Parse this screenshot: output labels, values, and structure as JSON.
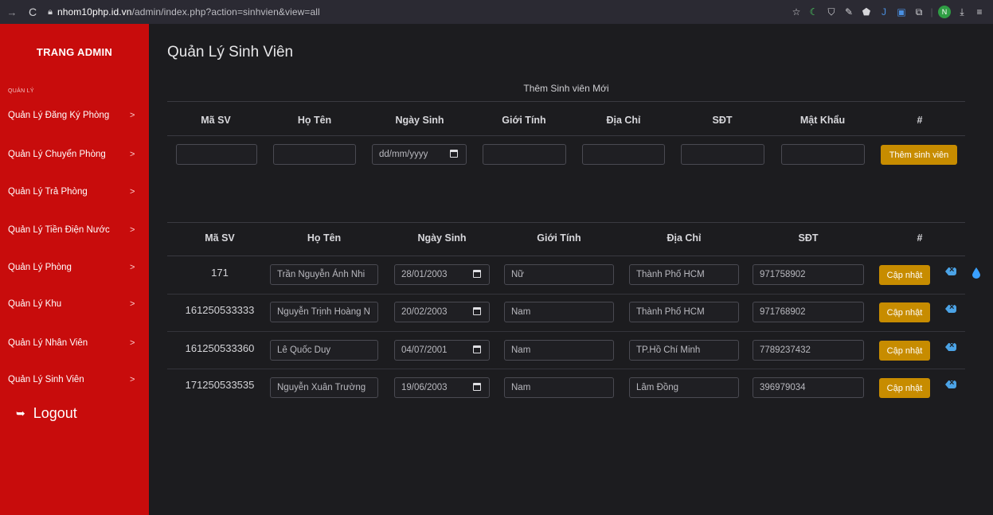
{
  "browser": {
    "url_host": "nhom10php.id.vn",
    "url_path": "/admin/index.php?action=sinhvien&view=all",
    "profile_initial": "N"
  },
  "sidebar": {
    "brand": "TRANG ADMIN",
    "section": "QUẢN LÝ",
    "items": [
      {
        "label": "Quản Lý Đăng Ký Phòng"
      },
      {
        "label": "Quản Lý Chuyển Phòng"
      },
      {
        "label": "Quản Lý Trả Phòng"
      },
      {
        "label": "Quản Lý Tiền Điện Nước"
      },
      {
        "label": "Quản Lý Phòng"
      },
      {
        "label": "Quản Lý Khu"
      },
      {
        "label": "Quản Lý Nhân Viên"
      },
      {
        "label": "Quản Lý Sinh Viên"
      }
    ],
    "logout": "Logout"
  },
  "main": {
    "title": "Quản Lý Sinh Viên",
    "add_form": {
      "caption": "Thêm Sinh viên Mới",
      "headers": [
        "Mã SV",
        "Họ Tên",
        "Ngày Sinh",
        "Giới Tính",
        "Địa Chỉ",
        "SĐT",
        "Mật Khẩu",
        "#"
      ],
      "date_placeholder": "dd/mm/yyyy",
      "submit_label": "Thêm sinh viên"
    },
    "list": {
      "headers": [
        "Mã SV",
        "Họ Tên",
        "Ngày Sinh",
        "Giới Tính",
        "Địa Chỉ",
        "SĐT",
        "#"
      ],
      "update_label": "Cập nhật",
      "rows": [
        {
          "id": "171",
          "name": "Trần Nguyễn Ánh Nhi",
          "dob": "28/01/2003",
          "gender": "Nữ",
          "address": "Thành Phố HCM",
          "phone": "971758902"
        },
        {
          "id": "161250533333",
          "name": "Nguyễn Trịnh Hoàng N",
          "dob": "20/02/2003",
          "gender": "Nam",
          "address": "Thành Phố HCM",
          "phone": "971768902"
        },
        {
          "id": "161250533360",
          "name": "Lê Quốc Duy",
          "dob": "04/07/2001",
          "gender": "Nam",
          "address": "TP.Hồ Chí Minh",
          "phone": "7789237432"
        },
        {
          "id": "171250533535",
          "name": "Nguyễn Xuân Trường",
          "dob": "19/06/2003",
          "gender": "Nam",
          "address": "Lâm Đồng",
          "phone": "396979034"
        }
      ]
    }
  },
  "colors": {
    "sidebar_bg": "#c80c0c",
    "main_bg": "#1c1c1f",
    "button_gold": "#c78c00",
    "delete_blue": "#4ba3e6"
  }
}
